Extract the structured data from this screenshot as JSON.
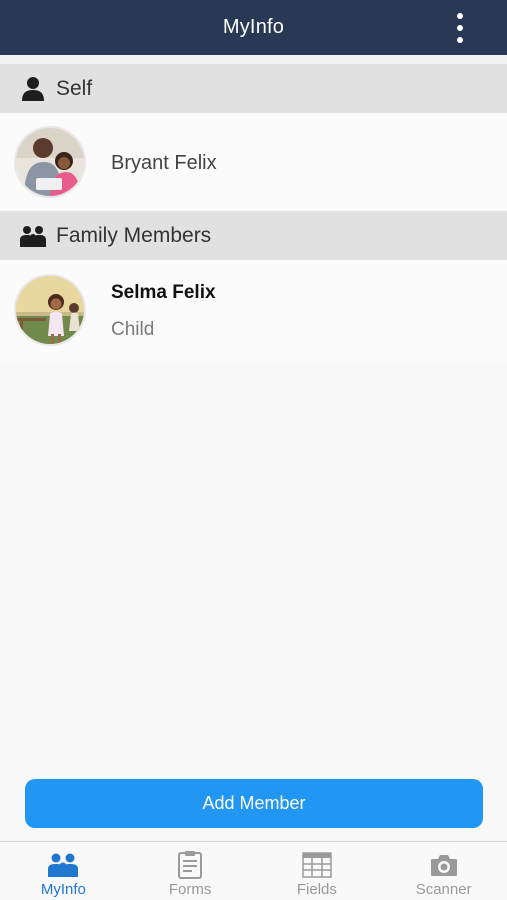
{
  "header": {
    "title": "MyInfo"
  },
  "sections": {
    "self": {
      "label": "Self"
    },
    "family": {
      "label": "Family Members"
    }
  },
  "self_member": {
    "name": "Bryant Felix"
  },
  "family_members": [
    {
      "name": "Selma Felix",
      "relation": "Child"
    }
  ],
  "actions": {
    "add_member_label": "Add Member"
  },
  "tabs": [
    {
      "label": "MyInfo",
      "icon": "family-icon",
      "active": true
    },
    {
      "label": "Forms",
      "icon": "forms-icon",
      "active": false
    },
    {
      "label": "Fields",
      "icon": "fields-icon",
      "active": false
    },
    {
      "label": "Scanner",
      "icon": "camera-icon",
      "active": false
    }
  ],
  "colors": {
    "header_bg": "#293955",
    "accent": "#2196f3",
    "tab_active": "#1f77d0",
    "tab_inactive": "#9a9a9a"
  }
}
